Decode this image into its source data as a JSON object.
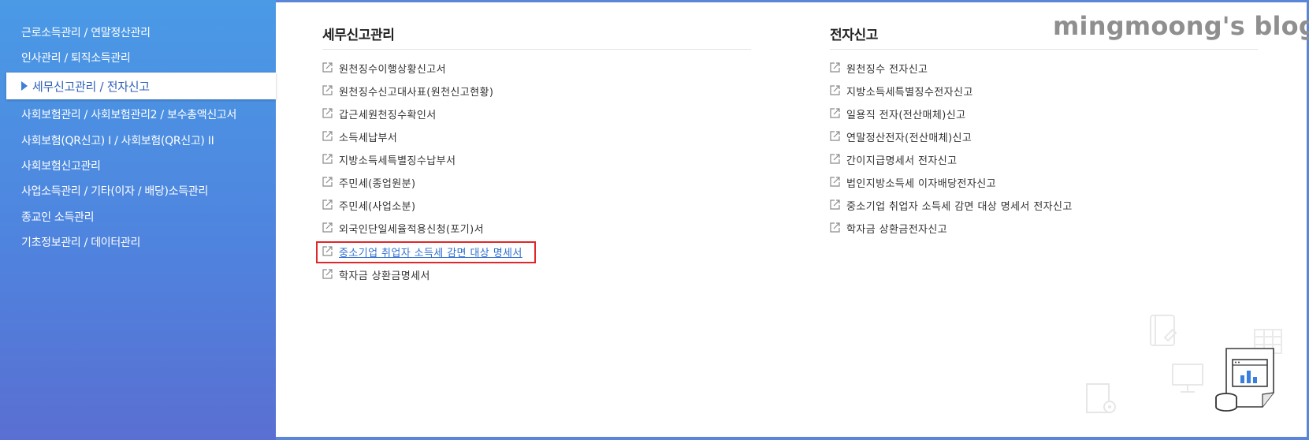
{
  "sidebar": {
    "items": [
      {
        "label": "근로소득관리 / 연말정산관리"
      },
      {
        "label": "인사관리 / 퇴직소득관리"
      },
      {
        "label": "세무신고관리 / 전자신고",
        "active": true
      },
      {
        "label": "사회보험관리 / 사회보험관리2 / 보수총액신고서"
      },
      {
        "label": "사회보험(QR신고) Ⅰ / 사회보험(QR신고) II"
      },
      {
        "label": "사회보험신고관리"
      },
      {
        "label": "사업소득관리 / 기타(이자 / 배당)소득관리"
      },
      {
        "label": "종교인 소득관리"
      },
      {
        "label": "기초정보관리 / 데이터관리"
      }
    ]
  },
  "tax_report": {
    "title": "세무신고관리",
    "items": [
      "원천징수이행상황신고서",
      "원천징수신고대사표(원천신고현황)",
      "갑근세원천징수확인서",
      "소득세납부서",
      "지방소득세특별징수납부서",
      "주민세(종업원분)",
      "주민세(사업소분)",
      "외국인단일세율적용신청(포기)서",
      "중소기업 취업자 소득세 감면 대상 명세서",
      "학자금 상환금명세서"
    ],
    "highlighted_index": 8
  },
  "e_filing": {
    "title": "전자신고",
    "items": [
      "원천징수 전자신고",
      "지방소득세특별징수전자신고",
      "일용직 전자(전산매체)신고",
      "연말정산전자(전산매체)신고",
      "간이지급명세서 전자신고",
      "법인지방소득세 이자배당전자신고",
      "중소기업 취업자 소득세 감면 대상 명세서 전자신고",
      "학자금 상환금전자신고"
    ]
  },
  "watermark": "mingmoong's blog",
  "icons": {
    "link": "external-link-icon",
    "sidebar_active": "triangle-right-icon",
    "decor": [
      "notebook-icon",
      "table-icon",
      "monitor-icon",
      "document-gear-icon",
      "report-chart-icon",
      "coins-icon"
    ]
  },
  "colors": {
    "sidebar_top": "#4a9ae6",
    "sidebar_bottom": "#5a6fd2",
    "frame_border": "#5b86d8",
    "highlight_box": "#e0282a",
    "link_highlight": "#2f6fd0"
  }
}
